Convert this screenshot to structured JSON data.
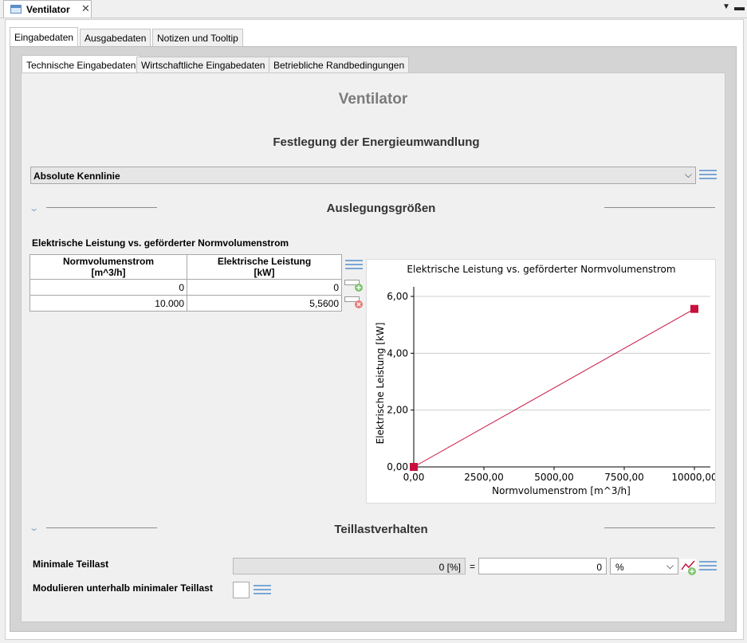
{
  "window": {
    "doc_tab_title": "Ventilator",
    "close_glyph": "✕",
    "view_menu_glyph": "▼",
    "minimize_glyph": "▬"
  },
  "tabs_level1": [
    "Eingabedaten",
    "Ausgabedaten",
    "Notizen und Tooltip"
  ],
  "tabs_level2": [
    "Technische Eingabedaten",
    "Wirtschaftliche Eingabedaten",
    "Betriebliche Randbedingungen"
  ],
  "page_title": "Ventilator",
  "energy_section": {
    "heading": "Festlegung der Energieumwandlung",
    "selected_option": "Absolute Kennlinie"
  },
  "design_section": {
    "heading": "Auslegungsgrößen",
    "table_title": "Elektrische Leistung vs. geförderter Normvolumenstrom",
    "columns": [
      {
        "name": "Normvolumenstrom",
        "unit": "[m^3/h]"
      },
      {
        "name": "Elektrische Leistung",
        "unit": "[kW]"
      }
    ],
    "rows": [
      [
        "0",
        "0"
      ],
      [
        "10.000",
        "5,5600"
      ]
    ]
  },
  "chart_data": {
    "type": "line",
    "title": "Elektrische Leistung vs. geförderter Normvolumenstrom",
    "xlabel": "Normvolumenstrom [m^3/h]",
    "ylabel": "Elektrische Leistung [kW]",
    "x": [
      0,
      10000
    ],
    "series": [
      {
        "values": [
          0,
          5.56
        ]
      }
    ],
    "xlim": [
      0,
      10000
    ],
    "ylim": [
      0,
      6
    ],
    "x_ticks": [
      0,
      2500,
      5000,
      7500,
      10000
    ],
    "x_tick_labels": [
      "0,00",
      "2500,00",
      "5000,00",
      "7500,00",
      "10000,00"
    ],
    "y_ticks": [
      0,
      2,
      4,
      6
    ],
    "y_tick_labels": [
      "0,00",
      "2,00",
      "4,00",
      "6,00"
    ],
    "grid": true,
    "color": "#c8103c"
  },
  "partload_section": {
    "heading": "Teillastverhalten",
    "min_partload_label": "Minimale Teillast",
    "min_partload_readonly": "0 [%]",
    "equals": "=",
    "min_partload_value": "0",
    "unit_selected": "%",
    "modulate_label": "Modulieren unterhalb minimaler Teillast"
  },
  "colors": {
    "accent": "#c8103c",
    "list_icon": "#7aa7d6"
  }
}
